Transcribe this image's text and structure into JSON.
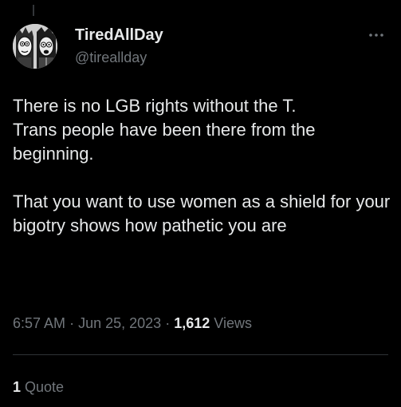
{
  "author": {
    "display_name": "TiredAllDay",
    "handle": "@tireallday"
  },
  "tweet": {
    "text": "There is no LGB rights without the T.\nTrans people have been there from the beginning.\n\nThat you want to use women as a shield for your bigotry shows how pathetic you are",
    "time": "6:57 AM",
    "separator": "·",
    "date": "Jun 25, 2023",
    "views_count": "1,612",
    "views_label": "Views"
  },
  "stats": {
    "quote_count": "1",
    "quote_label": "Quote"
  },
  "icons": {
    "more": "more-horizontal-icon"
  },
  "colors": {
    "background": "#000000",
    "primary_text": "#e7e9ea",
    "secondary_text": "#71767b",
    "divider": "#2f3336"
  }
}
